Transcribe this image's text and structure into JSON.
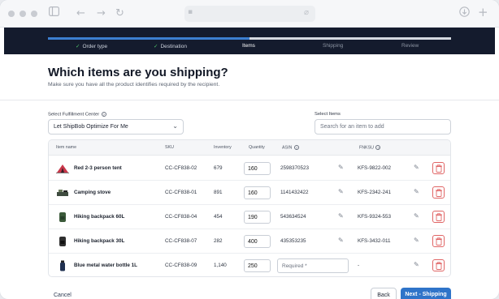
{
  "browser": {
    "back_icon": "arrow-left-icon",
    "forward_icon": "arrow-right-icon",
    "reload_icon": "reload-icon",
    "new_tab_icon": "plus-icon"
  },
  "stepper": {
    "progress_fraction": 0.5,
    "steps": [
      {
        "label": "Order type",
        "state": "done"
      },
      {
        "label": "Destination",
        "state": "done"
      },
      {
        "label": "Items",
        "state": "current"
      },
      {
        "label": "Shipping",
        "state": "todo"
      },
      {
        "label": "Review",
        "state": "todo"
      }
    ]
  },
  "header": {
    "title": "Which items are you shipping?",
    "subtitle": "Make sure you have all the product identifies required by the recipient."
  },
  "fulfillment": {
    "label": "Select Fulfillment Center",
    "selected": "Let ShipBob Optimize For Me"
  },
  "items_search": {
    "label": "Select Items",
    "placeholder": "Search for an item to add"
  },
  "table": {
    "columns": [
      "Item name",
      "SKU",
      "Inventory",
      "Quantity",
      "ASIN",
      "FNKSU"
    ],
    "rows": [
      {
        "name": "Red 2-3 person tent",
        "sku": "CC-CF838-02",
        "inventory": "679",
        "quantity": "160",
        "asin": "2598370523",
        "fnsku": "KFS-9822-002"
      },
      {
        "name": "Camping stove",
        "sku": "CC-CF838-01",
        "inventory": "891",
        "quantity": "160",
        "asin": "1141432422",
        "fnsku": "KFS-2342-241"
      },
      {
        "name": "Hiking backpack 60L",
        "sku": "CC-CF838-04",
        "inventory": "454",
        "quantity": "190",
        "asin": "543634524",
        "fnsku": "KFS-9324-553"
      },
      {
        "name": "Hiking backpack 30L",
        "sku": "CC-CF838-07",
        "inventory": "282",
        "quantity": "400",
        "asin": "435353235",
        "fnsku": "KFS-3432-011"
      },
      {
        "name": "Blue metal water bottle 1L",
        "sku": "CC-CF838-09",
        "inventory": "1,140",
        "quantity": "250",
        "asin_placeholder": "Required *",
        "fnsku": "-"
      }
    ]
  },
  "footer": {
    "cancel": "Cancel",
    "back": "Back",
    "next": "Next - Shipping"
  },
  "colors": {
    "stepper_bg": "#141b2d",
    "accent": "#2f74c9",
    "danger": "#e06565",
    "success": "#4fc46a"
  }
}
